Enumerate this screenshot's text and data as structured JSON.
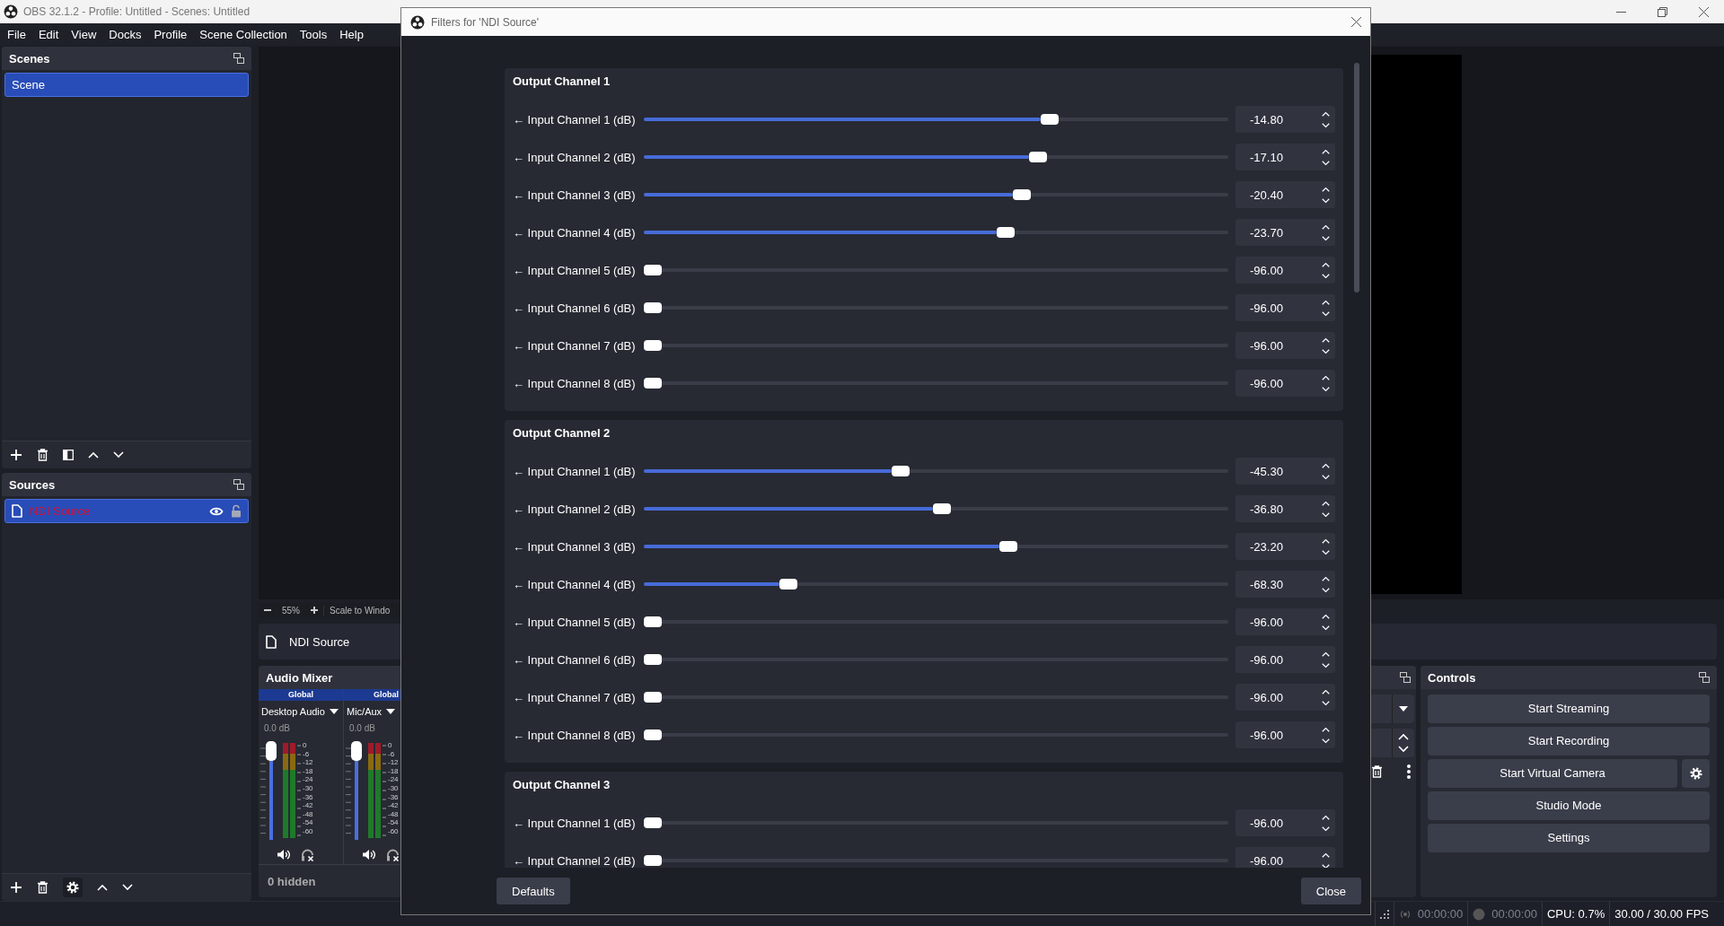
{
  "app_window": {
    "title": "OBS 32.1.2 - Profile: Untitled - Scenes: Untitled"
  },
  "menu": [
    "File",
    "Edit",
    "View",
    "Docks",
    "Profile",
    "Scene Collection",
    "Tools",
    "Help"
  ],
  "scenes": {
    "title": "Scenes",
    "items": [
      {
        "label": "Scene",
        "selected": true
      }
    ]
  },
  "sources": {
    "title": "Sources",
    "items": [
      {
        "label": "NDI Source",
        "selected": true
      }
    ]
  },
  "preview": {
    "zoom": "55%",
    "scale_mode": "Scale to Windo"
  },
  "source_toolbar": {
    "source": "NDI Source"
  },
  "audio_mixer": {
    "title": "Audio Mixer",
    "channels": [
      {
        "tag": "Global",
        "name": "Desktop Audio",
        "volume": "0.0 dB",
        "level": 1,
        "scale": [
          "0",
          "-6",
          "-12",
          "-18",
          "-24",
          "-30",
          "-36",
          "-42",
          "-48",
          "-54",
          "-60"
        ]
      },
      {
        "tag": "Global",
        "name": "Mic/Aux",
        "volume": "0.0 dB",
        "level": 1,
        "scale": [
          "0",
          "-6",
          "-12",
          "-18",
          "-24",
          "-30",
          "-36",
          "-42",
          "-48",
          "-54",
          "-60"
        ]
      }
    ],
    "footer": "0 hidden"
  },
  "controls": {
    "title": "Controls",
    "buttons": [
      {
        "label": "Start Streaming",
        "kind": "plain"
      },
      {
        "label": "Start Recording",
        "kind": "plain"
      },
      {
        "label": "Start Virtual Camera",
        "kind": "with_settings"
      },
      {
        "label": "Studio Mode",
        "kind": "plain"
      },
      {
        "label": "Settings",
        "kind": "plain"
      }
    ]
  },
  "status_bar": {
    "stream_time": "00:00:00",
    "record_time": "00:00:00",
    "cpu": "CPU: 0.7%",
    "fps": "30.00 / 30.00 FPS"
  },
  "dialog": {
    "title": "Filters for 'NDI Source'",
    "groups": [
      {
        "title": "Output Channel 1",
        "rows": [
          {
            "label": "← Input Channel 1 (dB)",
            "value": "-14.80",
            "level": 0.7
          },
          {
            "label": "← Input Channel 2 (dB)",
            "value": "-17.10",
            "level": 0.68
          },
          {
            "label": "← Input Channel 3 (dB)",
            "value": "-20.40",
            "level": 0.652
          },
          {
            "label": "← Input Channel 4 (dB)",
            "value": "-23.70",
            "level": 0.623
          },
          {
            "label": "← Input Channel 5 (dB)",
            "value": "-96.00",
            "level": 0
          },
          {
            "label": "← Input Channel 6 (dB)",
            "value": "-96.00",
            "level": 0
          },
          {
            "label": "← Input Channel 7 (dB)",
            "value": "-96.00",
            "level": 0
          },
          {
            "label": "← Input Channel 8 (dB)",
            "value": "-96.00",
            "level": 0
          }
        ]
      },
      {
        "title": "Output Channel 2",
        "rows": [
          {
            "label": "← Input Channel 1 (dB)",
            "value": "-45.30",
            "level": 0.437
          },
          {
            "label": "← Input Channel 2 (dB)",
            "value": "-36.80",
            "level": 0.51
          },
          {
            "label": "← Input Channel 3 (dB)",
            "value": "-23.20",
            "level": 0.628
          },
          {
            "label": "← Input Channel 4 (dB)",
            "value": "-68.30",
            "level": 0.239
          },
          {
            "label": "← Input Channel 5 (dB)",
            "value": "-96.00",
            "level": 0
          },
          {
            "label": "← Input Channel 6 (dB)",
            "value": "-96.00",
            "level": 0
          },
          {
            "label": "← Input Channel 7 (dB)",
            "value": "-96.00",
            "level": 0
          },
          {
            "label": "← Input Channel 8 (dB)",
            "value": "-96.00",
            "level": 0
          }
        ]
      },
      {
        "title": "Output Channel 3",
        "rows": [
          {
            "label": "← Input Channel 1 (dB)",
            "value": "-96.00",
            "level": 0
          },
          {
            "label": "← Input Channel 2 (dB)",
            "value": "-96.00",
            "level": 0
          }
        ]
      }
    ],
    "defaults_button": "Defaults",
    "close_button": "Close"
  }
}
